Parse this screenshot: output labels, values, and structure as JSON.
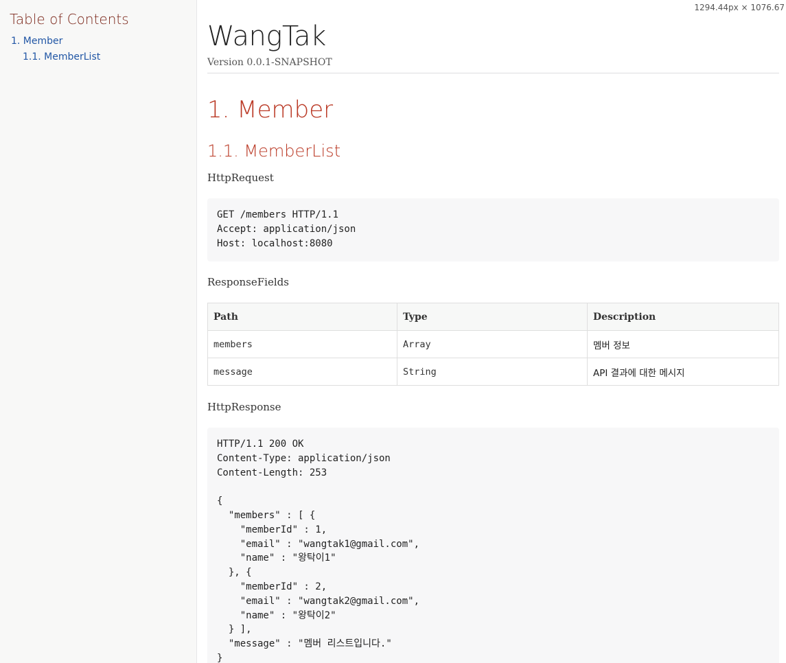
{
  "toc": {
    "title": "Table of Contents",
    "items": [
      {
        "label": "1. Member"
      },
      {
        "label": "1.1. MemberList"
      }
    ]
  },
  "dimensions_badge": "1294.44px × 1076.67",
  "header": {
    "title": "WangTak",
    "version": "Version 0.0.1-SNAPSHOT"
  },
  "section": {
    "title": "1. Member",
    "subsection": {
      "title": "1.1. MemberList",
      "request_label": "HttpRequest",
      "request_code": "GET /members HTTP/1.1\nAccept: application/json\nHost: localhost:8080",
      "fields_label": "ResponseFields",
      "fields_table": {
        "headers": [
          "Path",
          "Type",
          "Description"
        ],
        "rows": [
          [
            "members",
            "Array",
            "멤버 정보"
          ],
          [
            "message",
            "String",
            "API 결과에 대한 메시지"
          ]
        ]
      },
      "response_label": "HttpResponse",
      "response_code": "HTTP/1.1 200 OK\nContent-Type: application/json\nContent-Length: 253\n\n{\n  \"members\" : [ {\n    \"memberId\" : 1,\n    \"email\" : \"wangtak1@gmail.com\",\n    \"name\" : \"왕탁이1\"\n  }, {\n    \"memberId\" : 2,\n    \"email\" : \"wangtak2@gmail.com\",\n    \"name\" : \"왕탁이2\"\n  } ],\n  \"message\" : \"멤버 리스트입니다.\"\n}"
    }
  }
}
